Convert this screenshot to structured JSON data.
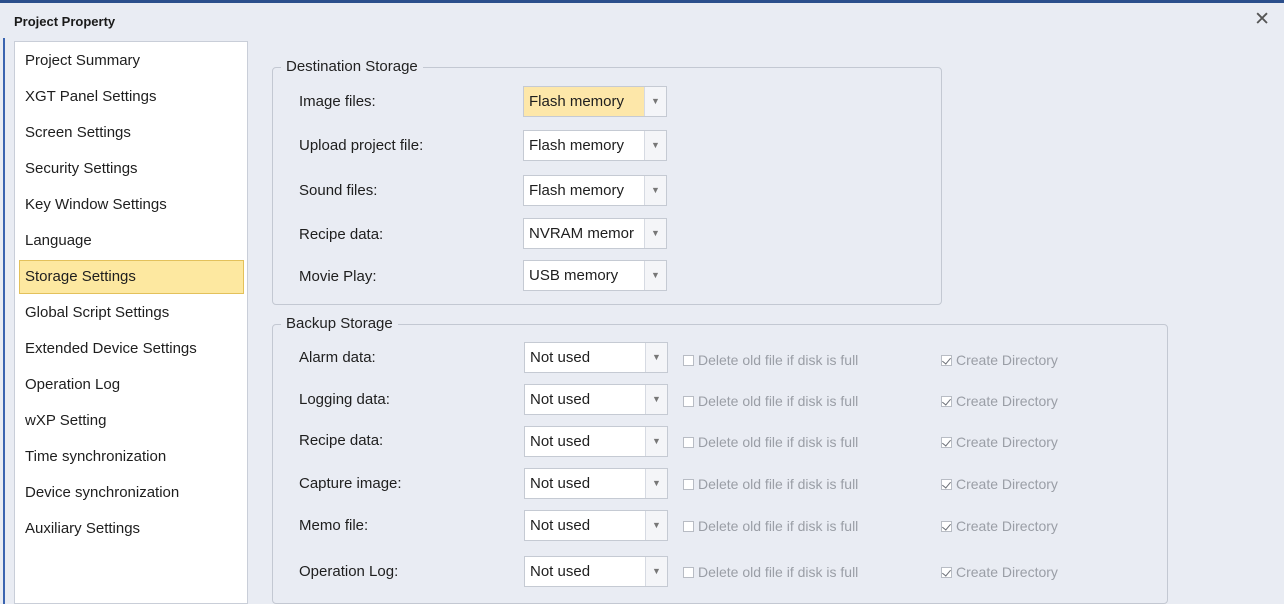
{
  "window": {
    "title": "Project Property",
    "close_glyph": "✕"
  },
  "sidebar": {
    "items": [
      {
        "label": "Project Summary"
      },
      {
        "label": "XGT Panel Settings"
      },
      {
        "label": "Screen Settings"
      },
      {
        "label": "Security Settings"
      },
      {
        "label": "Key Window Settings"
      },
      {
        "label": "Language"
      },
      {
        "label": "Storage Settings",
        "selected": true
      },
      {
        "label": "Global Script Settings"
      },
      {
        "label": "Extended Device Settings"
      },
      {
        "label": "Operation Log"
      },
      {
        "label": "wXP Setting"
      },
      {
        "label": "Time synchronization"
      },
      {
        "label": "Device synchronization"
      },
      {
        "label": "Auxiliary Settings"
      }
    ]
  },
  "destination": {
    "title": "Destination Storage",
    "rows": [
      {
        "label": "Image files:",
        "value": "Flash memory"
      },
      {
        "label": "Upload project file:",
        "value": "Flash memory"
      },
      {
        "label": "Sound files:",
        "value": "Flash memory"
      },
      {
        "label": "Recipe data:",
        "value": "NVRAM memor"
      },
      {
        "label": "Movie Play:",
        "value": "USB memory"
      }
    ]
  },
  "backup": {
    "title": "Backup Storage",
    "delete_label": "Delete old file if disk is full",
    "create_dir_label": "Create Directory",
    "rows": [
      {
        "label": "Alarm data:",
        "value": "Not used",
        "delete_checked": false,
        "create_dir_checked": true
      },
      {
        "label": "Logging data:",
        "value": "Not used",
        "delete_checked": false,
        "create_dir_checked": true
      },
      {
        "label": "Recipe data:",
        "value": "Not used",
        "delete_checked": false,
        "create_dir_checked": true
      },
      {
        "label": "Capture image:",
        "value": "Not used",
        "delete_checked": false,
        "create_dir_checked": true
      },
      {
        "label": "Memo file:",
        "value": "Not used",
        "delete_checked": false,
        "create_dir_checked": true
      },
      {
        "label": "Operation Log:",
        "value": "Not used",
        "delete_checked": false,
        "create_dir_checked": true
      }
    ]
  },
  "colors": {
    "accent": "#2b4f8c",
    "selected_bg": "#fde8a0",
    "background": "#e9ecf3"
  }
}
